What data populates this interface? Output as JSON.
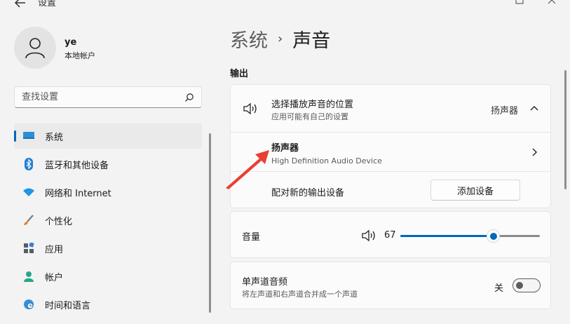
{
  "window": {
    "title": "设置"
  },
  "user": {
    "name": "ye",
    "account_type": "本地帐户"
  },
  "search": {
    "placeholder": "查找设置"
  },
  "sidebar": {
    "items": [
      {
        "label": "系统",
        "icon": "monitor-icon",
        "active": true
      },
      {
        "label": "蓝牙和其他设备",
        "icon": "bluetooth-icon"
      },
      {
        "label": "网络和 Internet",
        "icon": "wifi-icon"
      },
      {
        "label": "个性化",
        "icon": "brush-icon"
      },
      {
        "label": "应用",
        "icon": "apps-icon"
      },
      {
        "label": "帐户",
        "icon": "person-icon"
      },
      {
        "label": "时间和语言",
        "icon": "globe-clock-icon"
      }
    ]
  },
  "breadcrumb": {
    "parent": "系统",
    "separator": "›",
    "current": "声音"
  },
  "output": {
    "section_label": "输出",
    "choose": {
      "title": "选择播放声音的位置",
      "subtitle": "应用可能有自己的设置",
      "value": "扬声器"
    },
    "device": {
      "name": "扬声器",
      "description": "High Definition Audio Device"
    },
    "pair": {
      "label": "配对新的输出设备",
      "button": "添加设备"
    }
  },
  "volume": {
    "label": "音量",
    "value": 67,
    "max": 100
  },
  "mono": {
    "title": "单声道音频",
    "subtitle": "将左声道和右声道合并成一个声道",
    "state_label": "关",
    "on": false
  },
  "colors": {
    "accent": "#0067c0",
    "annotation": "#e8402f"
  }
}
